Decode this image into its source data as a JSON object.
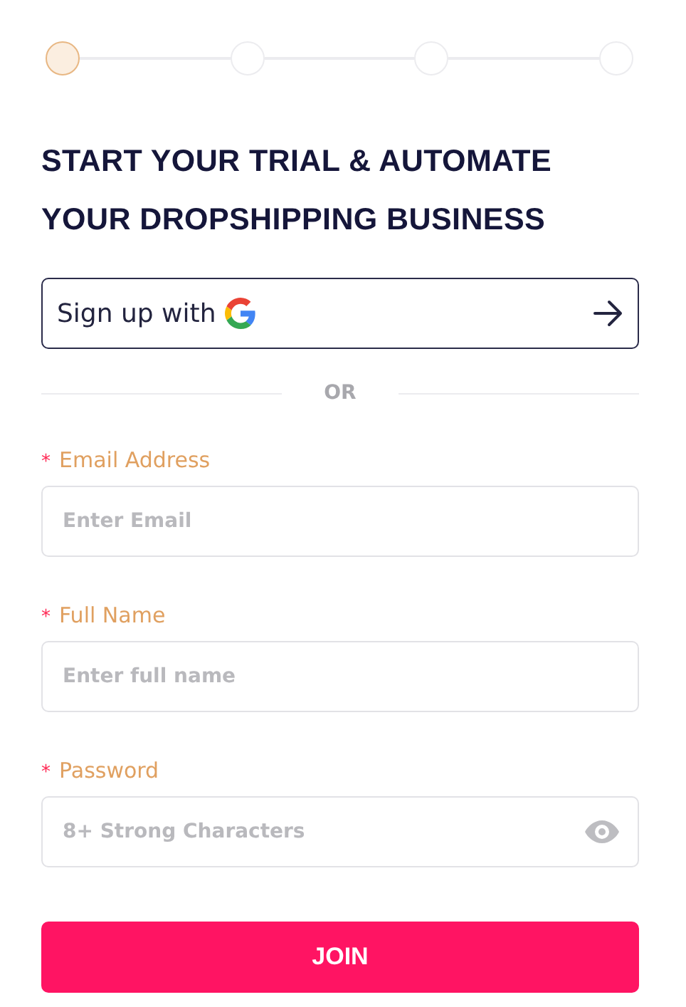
{
  "steps": [
    {
      "selected": true
    },
    {
      "selected": false
    },
    {
      "selected": false
    },
    {
      "selected": false
    }
  ],
  "heading": "START YOUR TRIAL & AUTOMATE YOUR DROPSHIPPING BUSINESS",
  "google_button": {
    "label": "Sign up with"
  },
  "divider": "OR",
  "fields": [
    {
      "kind": "text",
      "required_mark": "*",
      "label": "Email Address",
      "placeholder": "Enter Email"
    },
    {
      "kind": "text",
      "required_mark": "*",
      "label": "Full Name",
      "placeholder": "Enter full name"
    },
    {
      "kind": "password",
      "required_mark": "*",
      "label": "Password",
      "placeholder": "8+ Strong Characters"
    }
  ],
  "submit": "JOIN"
}
